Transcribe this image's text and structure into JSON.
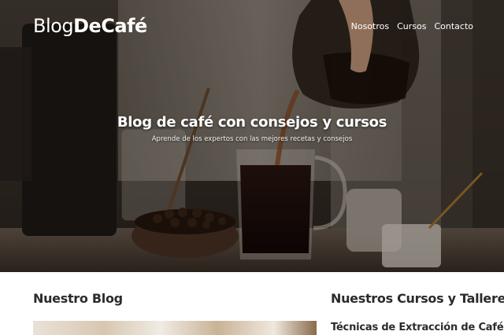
{
  "header": {
    "logo_part1": "Blog",
    "logo_part2": "DeCafé",
    "nav": [
      "Nosotros",
      "Cursos",
      "Contacto"
    ]
  },
  "hero": {
    "title": "Blog de café con consejos y cursos",
    "subtitle": "Aprende de los expertos con las mejores recetas y consejos"
  },
  "main": {
    "blog_heading": "Nuestro Blog",
    "courses_heading": "Nuestros Cursos y Talleres",
    "first_course_title": "Técnicas de Extracción de Café"
  }
}
